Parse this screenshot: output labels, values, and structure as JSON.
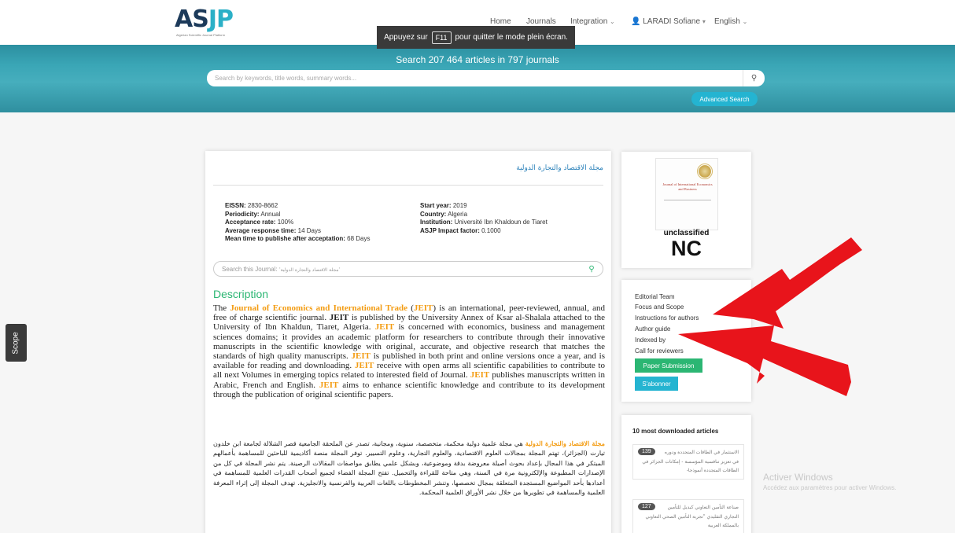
{
  "header": {
    "logo_main": "AS",
    "logo_accent": "JP",
    "logo_tagline": "Algerian Scientific Journal Platform",
    "nav": {
      "home": "Home",
      "journals": "Journals",
      "integration": "Integration",
      "user": "LARADI Sofiane",
      "language": "English"
    }
  },
  "fullscreen_banner": {
    "prefix": "Appuyez sur",
    "key": "F11",
    "suffix": "pour quitter le mode plein écran."
  },
  "hero": {
    "title": "Search 207 464 articles in 797 journals",
    "search_placeholder": "Search by keywords, title words, summary words...",
    "advanced_search": "Advanced Search"
  },
  "scope_tab": "Scope",
  "journal": {
    "title_ar": "مجلة الاقتصاد والتجارة الدولية",
    "meta_left": [
      {
        "label": "EISSN:",
        "value": "2830-8662"
      },
      {
        "label": "Periodicity:",
        "value": "Annual"
      },
      {
        "label": "Acceptance rate:",
        "value": "100%"
      },
      {
        "label": "Average response time:",
        "value": "14 Days"
      },
      {
        "label": "Mean time to publishe after acceptation:",
        "value": "68 Days"
      }
    ],
    "meta_right": [
      {
        "label": "Start year:",
        "value": "2019"
      },
      {
        "label": "Country:",
        "value": "Algeria"
      },
      {
        "label": "Institution:",
        "value": "Université Ibn Khaldoun de Tiaret"
      },
      {
        "label": "ASJP Impact factor:",
        "value": "0.1000"
      }
    ],
    "search_prefix": "Search this Journal:",
    "search_title_ar": "'مجلة الاقتصاد والتجارة الدولية'",
    "description_heading": "Description",
    "desc_en": {
      "p1": "The ",
      "name": "Journal of Economics and International Trade",
      "p2": " (",
      "abbr": "JEIT",
      "p3": ") is an international, peer-reviewed, annual, and free of charge scientific journal. ",
      "p4": " is published by the University Annex of Ksar al-Shalala attached to the University of Ibn Khaldun, Tiaret, Algeria. ",
      "p5": " is concerned with economics, business and management sciences domains; it provides an academic platform for researchers to contribute through their innovative manuscripts in the scientific knowledge with original, accurate, and objective research that matches the standards of high quality manuscripts. ",
      "p6": " is published in both print and online versions once a year, and is available for reading and downloading. ",
      "p7": " receive with open arms all scientific capabilities to contribute to all next Volumes in emerging topics related to interested field of Journal. ",
      "p8": " publishes manuscripts written in Arabic, French and English. ",
      "p9": " aims to enhance scientific knowledge and contribute to its development through the publication of original scientific papers."
    },
    "desc_ar": {
      "name": "مجلة الاقتصاد والتجارة الدولية",
      "text": " هي مجلة علمية دولية محكمة، متخصصة، سنوية، ومجانية، تصدر عن الملحقة الجامعية قصر الشلالة لجامعة ابن خلدون تيارت (الجزائر)، تهتم المجلة بمجالات العلوم الاقتصادية، والعلوم التجارية، وعلوم التسيير. توفر المجلة منصة أكاديمية للباحثين للمساهمة بأعمالهم المبتكر في هذا المجال بإعداد بحوث أصيلة معروضة بدقة وموضوعية، وبشكل علمي يطابق مواصفات المقالات الرصينة. يتم نشر المجلة في كل من الإصدارات المطبوعة والإلكترونية مرة في السنة، وهي متاحة للقراءة والتحميل. تفتح المجلة الفضاء لجميع أصحاب القدرات العلمية للمساهمة في أعدادها بأحد المواضيع المستجدة المتعلقة بمجال تخصصها، وتنشر المخطوطات باللغات العربية والفرنسية والانجليزية. تهدف المجلة إلى إثراء المعرفة العلمية والمساهمة في تطويرها من خلال نشر الأوراق العلمية المحكمة."
    }
  },
  "cover_card": {
    "cover_text": "Journal of International Economics and Business",
    "classification": "unclassified",
    "class_code": "NC"
  },
  "links_card": {
    "links": [
      "Editorial Team",
      "Focus and Scope",
      "Instructions for authors",
      "Author guide",
      "Indexed by",
      "Call for reviewers"
    ],
    "paper_submission": "Paper Submission",
    "subscribe": "S'abonner"
  },
  "top_articles": {
    "title": "10 most downloaded articles",
    "items": [
      {
        "count": "139",
        "title": "الاستثمار في الطاقات المتجددة ودوره في تعزيز تنافسية المؤسسة - إمكانات الجزائر في الطاقات المتجددة أنموذجا-"
      },
      {
        "count": "127",
        "title": "صناعة التأمين التعاوني كبديل للتأمين التجاري التقليدي \"تجربة التأمين الصحي التعاوني بالمملكة العربية"
      }
    ]
  },
  "watermark": {
    "title": "Activer Windows",
    "subtitle": "Accédez aux paramètres pour activer Windows."
  },
  "colors": {
    "accent_teal": "#2bb0c7",
    "green": "#2bb673",
    "orange": "#f39c12",
    "arrow_red": "#e8141b"
  }
}
